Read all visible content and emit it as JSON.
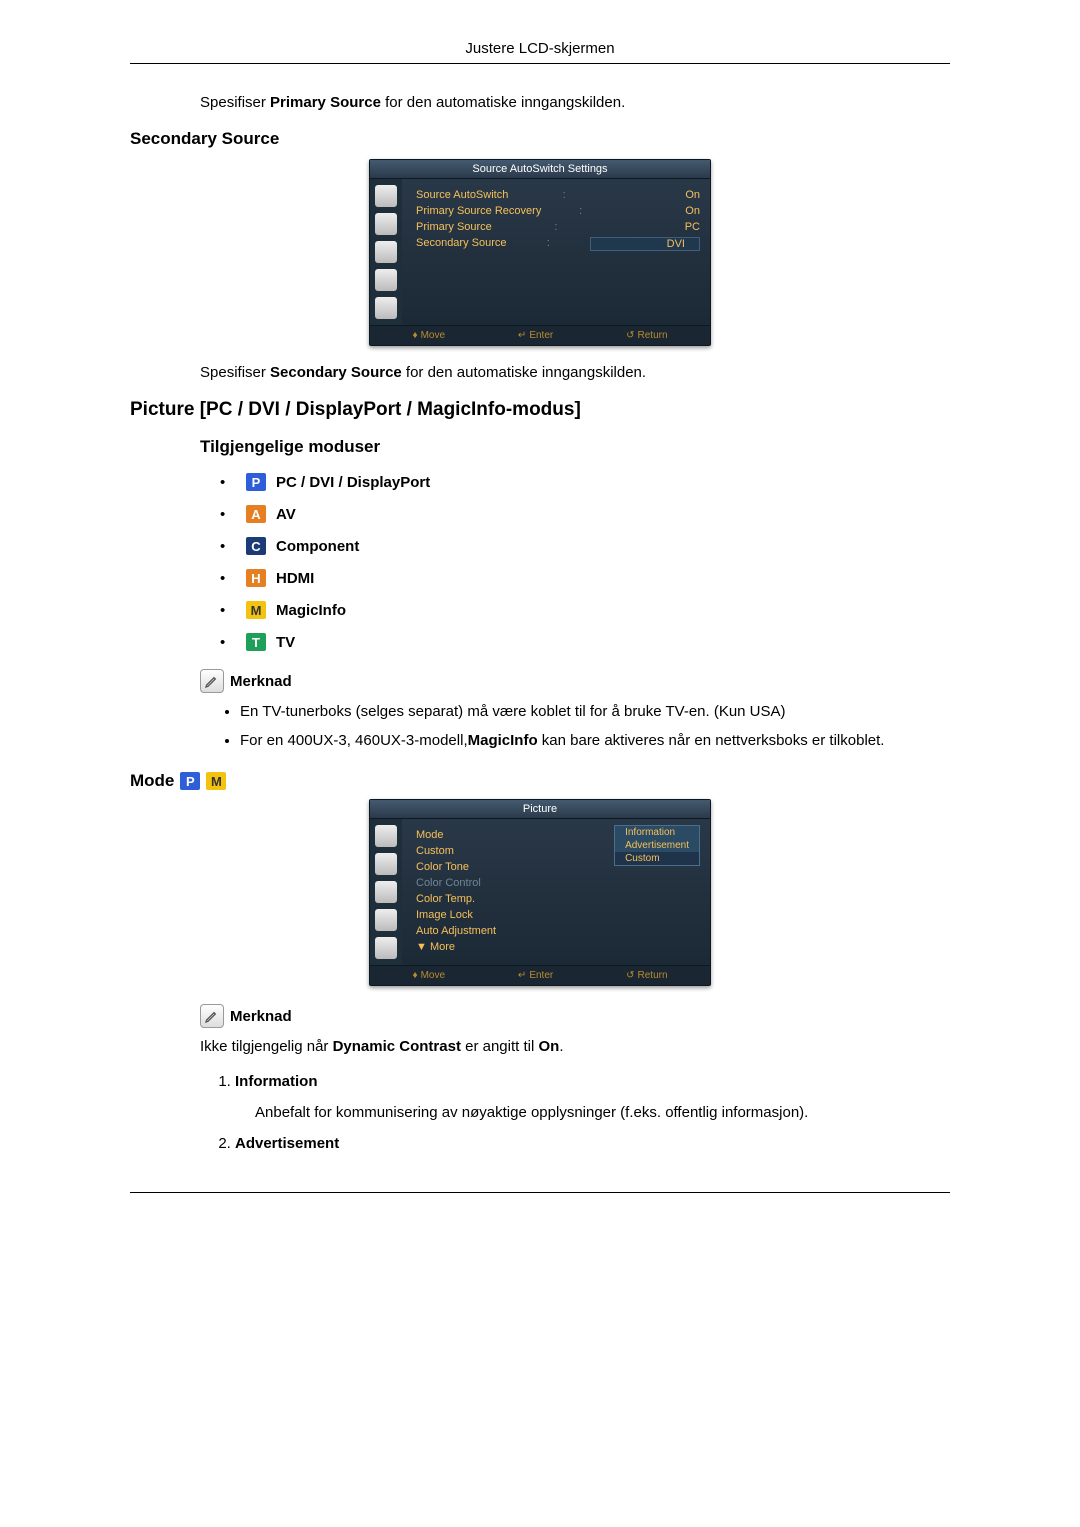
{
  "header": {
    "title": "Justere LCD-skjermen"
  },
  "primary_text": {
    "pre": "Spesifiser ",
    "strong": "Primary Source",
    "post": " for den automatiske inngangskilden."
  },
  "secondary_source_heading": "Secondary Source",
  "secondary_text": {
    "pre": "Spesifiser ",
    "strong": "Secondary Source",
    "post": " for den automatiske inngangskilden."
  },
  "picture_heading": "Picture [PC / DVI / DisplayPort / MagicInfo-modus]",
  "modes_heading": "Tilgjengelige moduser",
  "modes": [
    {
      "key": "P",
      "cls": "icon-p",
      "label": "PC / DVI / DisplayPort"
    },
    {
      "key": "A",
      "cls": "icon-a",
      "label": "AV"
    },
    {
      "key": "C",
      "cls": "icon-c",
      "label": "Component"
    },
    {
      "key": "H",
      "cls": "icon-h",
      "label": "HDMI"
    },
    {
      "key": "M",
      "cls": "icon-m",
      "label": "MagicInfo"
    },
    {
      "key": "T",
      "cls": "icon-t",
      "label": "TV"
    }
  ],
  "note_label": "Merknad",
  "note1_bullets": [
    "En TV-tunerboks (selges separat) må være koblet til for å bruke TV-en. (Kun USA)",
    "For en 400UX-3, 460UX-3-modell,MagicInfo kan bare aktiveres når en nettverksboks er tilkoblet."
  ],
  "note1_strong_in_1": "MagicInfo",
  "mode_heading": "Mode",
  "note2_text": {
    "pre": "Ikke tilgjengelig når ",
    "s1": "Dynamic Contrast",
    "mid": " er angitt til ",
    "s2": "On",
    "post": "."
  },
  "ol": [
    {
      "title": "Information",
      "desc": "Anbefalt for kommunisering av nøyaktige opplysninger (f.eks. offentlig informasjon)."
    },
    {
      "title": "Advertisement",
      "desc": ""
    }
  ],
  "osd1": {
    "title": "Source AutoSwitch Settings",
    "rows": [
      {
        "label": "Source AutoSwitch",
        "value": "On"
      },
      {
        "label": "Primary Source Recovery",
        "value": "On"
      },
      {
        "label": "Primary Source",
        "value": "PC"
      },
      {
        "label": "Secondary Source",
        "value": "DVI",
        "boxed": true
      }
    ],
    "foot": [
      "Move",
      "Enter",
      "Return"
    ]
  },
  "osd2": {
    "title": "Picture",
    "rows": [
      {
        "label": "Mode",
        "sel": true
      },
      {
        "label": "Custom"
      },
      {
        "label": "Color Tone"
      },
      {
        "label": "Color Control",
        "dim": true
      },
      {
        "label": "Color Temp."
      },
      {
        "label": "Image Lock"
      },
      {
        "label": "Auto Adjustment"
      },
      {
        "label": "▼ More"
      }
    ],
    "dropdown": [
      "Information",
      "Advertisement",
      "Custom"
    ],
    "foot": [
      "Move",
      "Enter",
      "Return"
    ]
  }
}
